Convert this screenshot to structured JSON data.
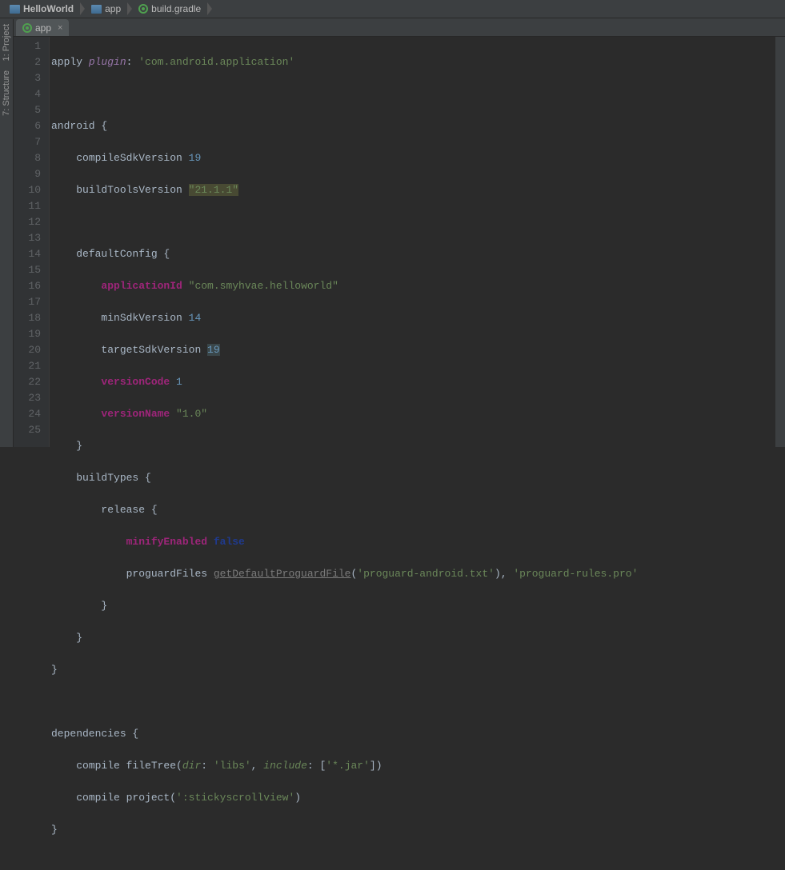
{
  "breadcrumb": [
    {
      "label": "HelloWorld",
      "icon": "folder"
    },
    {
      "label": "app",
      "icon": "folder"
    },
    {
      "label": "build.gradle",
      "icon": "gradle"
    }
  ],
  "tab": {
    "label": "app",
    "icon": "gradle"
  },
  "sidebar": {
    "project": "1: Project",
    "structure": "7: Structure"
  },
  "code": {
    "l1": {
      "apply": "apply ",
      "plugin": "plugin",
      "colon": ": ",
      "val": "'com.android.application'"
    },
    "l3": {
      "android": "android {"
    },
    "l4": {
      "k": "compileSdkVersion ",
      "v": "19"
    },
    "l5": {
      "k": "buildToolsVersion ",
      "v": "\"21.1.1\""
    },
    "l7": {
      "t": "defaultConfig {"
    },
    "l8": {
      "k": "applicationId ",
      "v": "\"com.smyhvae.helloworld\""
    },
    "l9": {
      "k": "minSdkVersion ",
      "v": "14"
    },
    "l10": {
      "k": "targetSdkVersion ",
      "v": "19"
    },
    "l11": {
      "k": "versionCode ",
      "v": "1"
    },
    "l12": {
      "k": "versionName ",
      "v": "\"1.0\""
    },
    "l13": {
      "t": "}"
    },
    "l14": {
      "t": "buildTypes {"
    },
    "l15": {
      "t": "release {"
    },
    "l16": {
      "k": "minifyEnabled ",
      "v": "false"
    },
    "l17": {
      "a": "proguardFiles ",
      "b": "getDefaultProguardFile",
      "c": "(",
      "d": "'proguard-android.txt'",
      "e": "), ",
      "f": "'proguard-rules.pro'"
    },
    "l18": {
      "t": "}"
    },
    "l19": {
      "t": "}"
    },
    "l20": {
      "t": "}"
    },
    "l22": {
      "t": "dependencies {"
    },
    "l23": {
      "a": "compile fileTree(",
      "b": "dir",
      "c": ": ",
      "d": "'libs'",
      "e": ", ",
      "f": "include",
      "g": ": [",
      "h": "'*.jar'",
      "i": "])"
    },
    "l24": {
      "a": "compile project(",
      "b": "':stickyscrollview'",
      "c": ")"
    },
    "l25": {
      "t": "}"
    }
  },
  "lines": [
    "1",
    "2",
    "3",
    "4",
    "5",
    "6",
    "7",
    "8",
    "9",
    "10",
    "11",
    "12",
    "13",
    "14",
    "15",
    "16",
    "17",
    "18",
    "19",
    "20",
    "21",
    "22",
    "23",
    "24",
    "25"
  ]
}
